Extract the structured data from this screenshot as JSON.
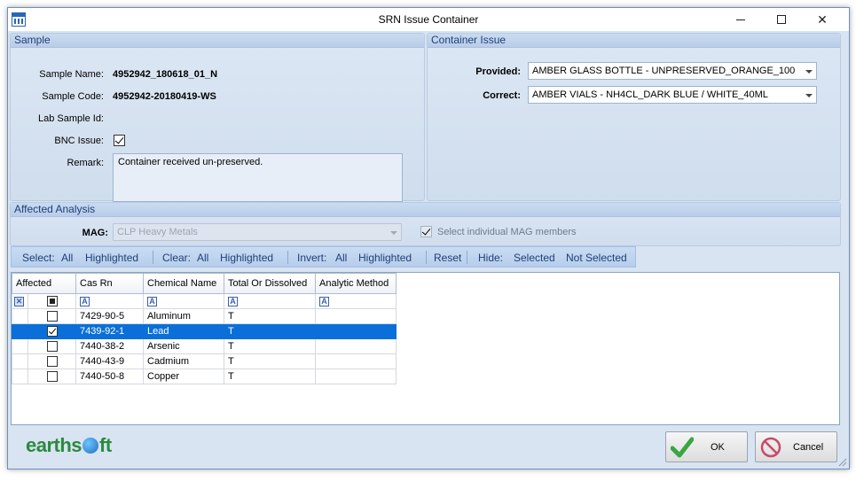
{
  "window": {
    "title": "SRN Issue Container"
  },
  "sample": {
    "header": "Sample",
    "name_label": "Sample Name:",
    "name_value": "4952942_180618_01_N",
    "code_label": "Sample Code:",
    "code_value": "4952942-20180419-WS",
    "lab_id_label": "Lab Sample Id:",
    "lab_id_value": "",
    "bnc_label": "BNC Issue:",
    "bnc_checked": true,
    "remark_label": "Remark:",
    "remark_value": "Container received un-preserved."
  },
  "container_issue": {
    "header": "Container Issue",
    "provided_label": "Provided:",
    "provided_value": "AMBER GLASS BOTTLE - UNPRESERVED_ORANGE_100",
    "correct_label": "Correct:",
    "correct_value": "AMBER VIALS - NH4CL_DARK BLUE / WHITE_40ML"
  },
  "affected_analysis": {
    "header": "Affected Analysis",
    "mag_label": "MAG:",
    "mag_value": "CLP Heavy Metals",
    "select_members_label": "Select individual MAG members",
    "select_members_checked": true
  },
  "toolbar": {
    "select_label": "Select:",
    "select_all": "All",
    "select_highlighted": "Highlighted",
    "clear_label": "Clear:",
    "clear_all": "All",
    "clear_highlighted": "Highlighted",
    "invert_label": "Invert:",
    "invert_all": "All",
    "invert_highlighted": "Highlighted",
    "reset": "Reset",
    "hide_label": "Hide:",
    "hide_selected": "Selected",
    "hide_not_selected": "Not Selected"
  },
  "grid": {
    "columns": [
      "Affected",
      "Cas Rn",
      "Chemical Name",
      "Total Or Dissolved",
      "Analytic Method"
    ],
    "filter_glyph": "A",
    "rows": [
      {
        "checked": false,
        "cas_rn": "7429-90-5",
        "chemical_name": "Aluminum",
        "total_or_dissolved": "T",
        "analytic_method": ""
      },
      {
        "checked": true,
        "cas_rn": "7439-92-1",
        "chemical_name": "Lead",
        "total_or_dissolved": "T",
        "analytic_method": ""
      },
      {
        "checked": false,
        "cas_rn": "7440-38-2",
        "chemical_name": "Arsenic",
        "total_or_dissolved": "T",
        "analytic_method": ""
      },
      {
        "checked": false,
        "cas_rn": "7440-43-9",
        "chemical_name": "Cadmium",
        "total_or_dissolved": "T",
        "analytic_method": ""
      },
      {
        "checked": false,
        "cas_rn": "7440-50-8",
        "chemical_name": "Copper",
        "total_or_dissolved": "T",
        "analytic_method": ""
      }
    ],
    "selected_row_index": 1
  },
  "footer": {
    "logo_text_before": "earths",
    "logo_text_after": "ft",
    "ok_label": "OK",
    "cancel_label": "Cancel"
  },
  "colors": {
    "accent": "#0a6fd8",
    "header_text": "#1f3f78",
    "logo_green": "#2b8a3e"
  },
  "icons": [
    "app-calendar-icon",
    "minimize-icon",
    "maximize-icon",
    "close-icon",
    "checkmark-icon",
    "cancel-circle-icon",
    "globe-icon",
    "filter-icon",
    "dropdown-arrow-icon"
  ]
}
